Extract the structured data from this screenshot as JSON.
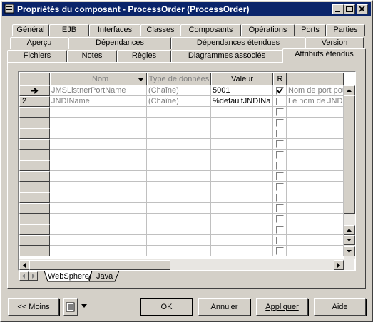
{
  "window": {
    "title": "Propriétés du composant - ProcessOrder (ProcessOrder)"
  },
  "tabs": {
    "row1": [
      "Général",
      "EJB",
      "Interfaces",
      "Classes",
      "Composants",
      "Opérations",
      "Ports",
      "Parties"
    ],
    "row2": [
      "Aperçu",
      "Dépendances",
      "Dépendances étendues",
      "Version"
    ],
    "row3": [
      "Fichiers",
      "Notes",
      "Règles",
      "Diagrammes associés",
      "Attributs étendus"
    ],
    "active": "Attributs étendus"
  },
  "grid": {
    "columns": [
      "Nom",
      "Type de données",
      "Valeur",
      "R",
      ""
    ],
    "rows": [
      {
        "marker": "→",
        "name": "JMSListnerPortName",
        "type": "(Chaîne)",
        "value": "5001",
        "checked": true,
        "description": "Nom de port pou"
      },
      {
        "marker": "2",
        "name": "JNDIName",
        "type": "(Chaîne)",
        "value": "%defaultJNDINa",
        "checked": false,
        "description": "Le nom de JNDI"
      }
    ]
  },
  "sheet_tabs": [
    "WebSphere",
    "Java"
  ],
  "buttons": {
    "less": "<< Moins",
    "ok": "OK",
    "cancel": "Annuler",
    "apply": "Appliquer",
    "help": "Aide"
  }
}
